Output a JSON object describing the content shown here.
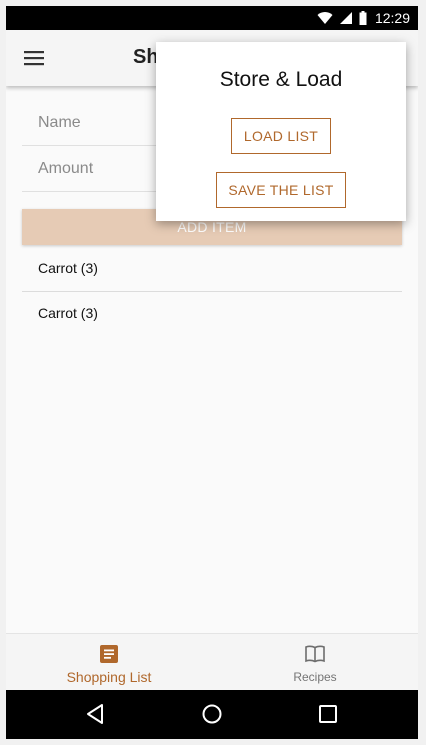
{
  "status_bar": {
    "time": "12:29"
  },
  "app_bar": {
    "title": "Sh",
    "menu_icon": "hamburger-menu-icon"
  },
  "form": {
    "name_label": "Name",
    "name_value": "",
    "amount_label": "Amount",
    "amount_value": "",
    "add_button": "ADD ITEM"
  },
  "list": {
    "items": [
      "Carrot (3)",
      "Carrot (3)"
    ]
  },
  "popup": {
    "title": "Store & Load",
    "load_button": "LOAD LIST",
    "save_button": "SAVE THE LIST"
  },
  "bottom_nav": {
    "items": [
      {
        "label": "Shopping List",
        "icon": "list-document-icon",
        "active": true
      },
      {
        "label": "Recipes",
        "icon": "open-book-icon",
        "active": false
      }
    ]
  },
  "colors": {
    "accent": "#b0682c",
    "add_button_bg": "#e6cbb5",
    "background": "#fafafa"
  }
}
